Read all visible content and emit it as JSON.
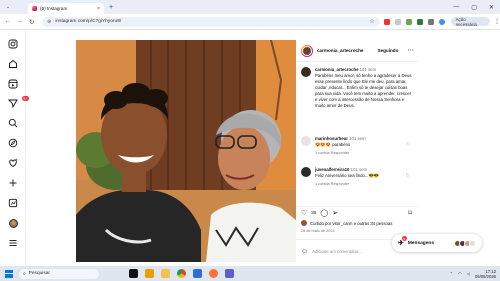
{
  "browser": {
    "tab_title": "(9) Instagram",
    "url": "instagram.com/p/C7giYhyoru8/",
    "access_label": "Ação necessária"
  },
  "rail": {
    "notifications_badge": "9+"
  },
  "post": {
    "username": "carmonia_artecroche",
    "follow_label": "Seguindo",
    "caption": {
      "user": "carmonia_artecroche",
      "time": "101 sem",
      "text": "Parabéns meu amor, só tenho a agradecer a Deus esse presente lindo que Ele me deu, para amar, cuidar ,educar... Enfim sô te desejar coisas boas para sua vida. Você tem muito a aprender, crescer e viver com a intercessão de Nossa Senhora e muito amor de Deus."
    },
    "comments": [
      {
        "user": "marinhosurheur",
        "time": "101 sem",
        "text": "😍😍😍 parabéns",
        "meta": "1 curtida   Responder"
      },
      {
        "user": "juvenalferreira10",
        "time": "101 sem",
        "text": "Feliz Aniversário sea lindo...😎😎",
        "meta": "1 curtida   Responder"
      }
    ],
    "likes_count": "35",
    "liked_by": "Curtido por vitor_carm e outras 34 pessoas",
    "date": "28 de maio de 2024",
    "add_comment_placeholder": "Adicione um comentário..."
  },
  "messages": {
    "label": "Mensagens",
    "badge": "9"
  },
  "taskbar": {
    "search_label": "Pesquisar",
    "time": "17:12",
    "date": "05/05/2026"
  },
  "colors": {
    "accent": "#0095f6",
    "badge": "#ff3040"
  }
}
